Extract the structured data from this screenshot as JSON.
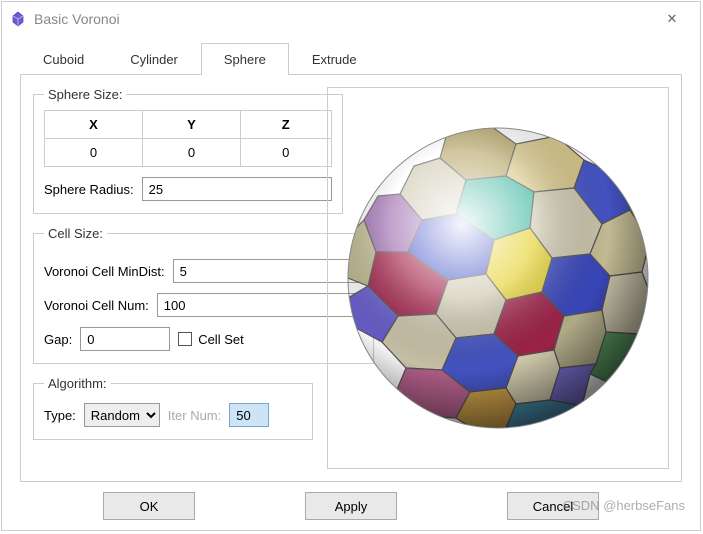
{
  "window": {
    "title": "Basic Voronoi",
    "icon": "app-voronoi-icon"
  },
  "tabs": {
    "items": [
      {
        "label": "Cuboid",
        "active": false
      },
      {
        "label": "Cylinder",
        "active": false
      },
      {
        "label": "Sphere",
        "active": true
      },
      {
        "label": "Extrude",
        "active": false
      }
    ]
  },
  "sphere_size": {
    "legend": "Sphere Size:",
    "headers": {
      "x": "X",
      "y": "Y",
      "z": "Z"
    },
    "values": {
      "x": "0",
      "y": "0",
      "z": "0"
    },
    "radius_label": "Sphere Radius:",
    "radius_value": "25"
  },
  "cell_size": {
    "legend": "Cell Size:",
    "min_dist_label": "Voronoi Cell MinDist:",
    "min_dist_value": "5",
    "num_label": "Voronoi Cell Num:",
    "num_value": "100",
    "gap_label": "Gap:",
    "gap_value": "0",
    "cell_set_label": "Cell Set",
    "cell_set_checked": false
  },
  "algorithm": {
    "legend": "Algorithm:",
    "type_label": "Type:",
    "type_value": "Random",
    "iter_label": "Iter Num:",
    "iter_value": "50"
  },
  "buttons": {
    "ok": "OK",
    "apply": "Apply",
    "cancel": "Cancel"
  },
  "watermark": "CSDN @herbseFans"
}
